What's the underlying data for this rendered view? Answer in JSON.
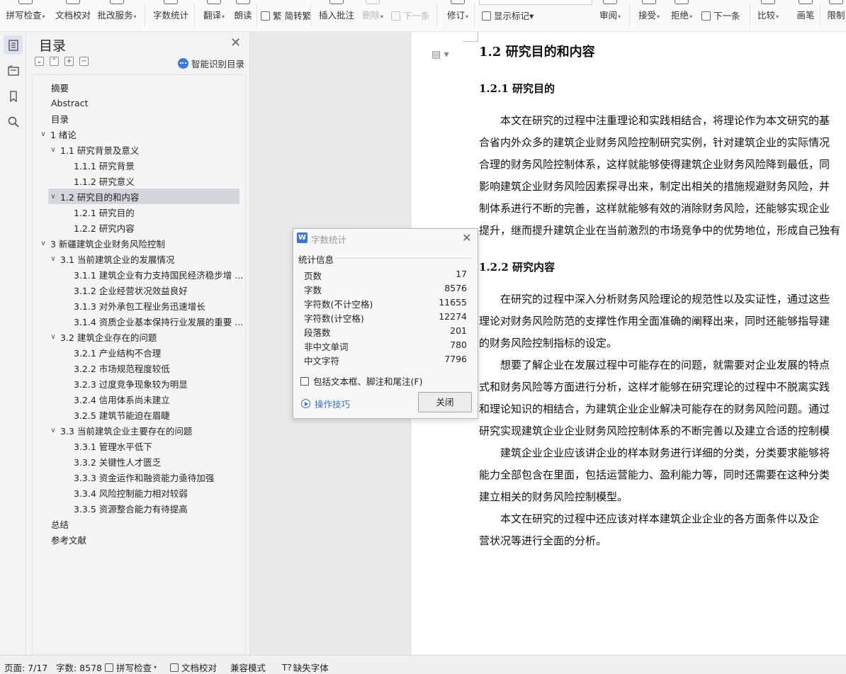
{
  "ribbon": {
    "items": [
      {
        "label": "拼写检查",
        "dropdown": true
      },
      {
        "label": "文档校对",
        "dropdown": false
      },
      {
        "label": "批改服务",
        "dropdown": true
      },
      {
        "label": "字数统计",
        "dropdown": false
      },
      {
        "label": "翻译",
        "dropdown": true
      },
      {
        "label": "朗读",
        "dropdown": false
      },
      {
        "label": "繁 简转繁",
        "dropdown": false
      },
      {
        "label": "插入批注",
        "dropdown": false
      },
      {
        "label": "删除",
        "dropdown": true,
        "disabled": true
      },
      {
        "label": "下一条",
        "dropdown": false,
        "disabled": true
      },
      {
        "label": "修订",
        "dropdown": true
      },
      {
        "label": "显示标记",
        "dropdown": true
      },
      {
        "label": "审阅",
        "dropdown": true
      },
      {
        "label": "接受",
        "dropdown": true
      },
      {
        "label": "拒绝",
        "dropdown": true
      },
      {
        "label": "下一条",
        "dropdown": false
      },
      {
        "label": "比较",
        "dropdown": true
      },
      {
        "label": "画笔",
        "dropdown": false
      },
      {
        "label": "限制",
        "dropdown": false
      }
    ],
    "dropdown_glyph": "▾"
  },
  "rail": {
    "icons": [
      "toc-icon",
      "outline-icon",
      "bookmark-icon",
      "search-icon"
    ]
  },
  "toc": {
    "title": "目录",
    "close_glyph": "✕",
    "tool_glyphs": [
      "⌄",
      "⌃",
      "+",
      "−"
    ],
    "smart_label": "智能识别目录",
    "items": [
      {
        "label": "摘要",
        "level": 0,
        "arrow": ""
      },
      {
        "label": "Abstract",
        "level": 0,
        "arrow": ""
      },
      {
        "label": "目录",
        "level": 0,
        "arrow": ""
      },
      {
        "label": "1  绪论",
        "level": 0,
        "arrow": "∨"
      },
      {
        "label": "1.1  研究背景及意义",
        "level": 1,
        "arrow": "∨"
      },
      {
        "label": "1.1.1 研究背景",
        "level": 2,
        "arrow": ""
      },
      {
        "label": "1.1.2 研究意义",
        "level": 2,
        "arrow": ""
      },
      {
        "label": "1.2 研究目的和内容",
        "level": 1,
        "arrow": "∨",
        "selected": true
      },
      {
        "label": "1.2.1 研究目的",
        "level": 2,
        "arrow": ""
      },
      {
        "label": "1.2.2 研究内容",
        "level": 2,
        "arrow": ""
      },
      {
        "label": "3  新疆建筑企业财务风险控制",
        "level": 0,
        "arrow": "∨"
      },
      {
        "label": "3.1  当前建筑企业的发展情况",
        "level": 1,
        "arrow": "∨"
      },
      {
        "label": "3.1.1 建筑企业有力支持国民经济稳步增 ...",
        "level": 2,
        "arrow": ""
      },
      {
        "label": "3.1.2 企业经营状况效益良好",
        "level": 2,
        "arrow": ""
      },
      {
        "label": "3.1.3  对外承包工程业务迅速增长",
        "level": 2,
        "arrow": ""
      },
      {
        "label": "3.1.4  资质企业基本保持行业发展的重要 ...",
        "level": 2,
        "arrow": ""
      },
      {
        "label": "3.2 建筑企业存在的问题",
        "level": 1,
        "arrow": "∨"
      },
      {
        "label": "3.2.1 产业结构不合理",
        "level": 2,
        "arrow": ""
      },
      {
        "label": "3.2.2 市场规范程度较低",
        "level": 2,
        "arrow": ""
      },
      {
        "label": "3.2.3 过度竞争现象较为明显",
        "level": 2,
        "arrow": ""
      },
      {
        "label": "3.2.4 信用体系尚未建立",
        "level": 2,
        "arrow": ""
      },
      {
        "label": "3.2.5 建筑节能迫在眉睫",
        "level": 2,
        "arrow": ""
      },
      {
        "label": "3.3 当前建筑企业主要存在的问题",
        "level": 1,
        "arrow": "∨"
      },
      {
        "label": "3.3.1 管理水平低下",
        "level": 2,
        "arrow": ""
      },
      {
        "label": "3.3.2 关键性人才匮乏",
        "level": 2,
        "arrow": ""
      },
      {
        "label": "3.3.3 资金运作和融资能力亟待加强",
        "level": 2,
        "arrow": ""
      },
      {
        "label": "3.3.4 风险控制能力相对较弱",
        "level": 2,
        "arrow": ""
      },
      {
        "label": "3.3.5 资源整合能力有待提高",
        "level": 2,
        "arrow": ""
      },
      {
        "label": "总结",
        "level": 0,
        "arrow": ""
      },
      {
        "label": "参考文献",
        "level": 0,
        "arrow": ""
      }
    ]
  },
  "document": {
    "side_icon": "▤ ▾",
    "h2": "1.2 研究目的和内容",
    "h3a": "1.2.1 研究目的",
    "para1": [
      "　　本文在研究的过程中注重理论和实践相结合，将理论作为本文研究的基",
      "合省内外众多的建筑企业财务风险控制研究实例，针对建筑企业的实际情况",
      "合理的财务风险控制体系，这样就能够使得建筑企业财务风险降到最低，同",
      "影响建筑企业财务风险因素探寻出来，制定出相关的措施规避财务风险，并",
      "制体系进行不断的完善，这样就能够有效的消除财务风险，还能够实现企业",
      "提升，继而提升建筑企业在当前激烈的市场竞争中的优势地位，形成自己独有"
    ],
    "h3b": "1.2.2 研究内容",
    "para2": [
      "　　在研究的过程中深入分析财务风险理论的规范性以及实证性，通过这些",
      "理论对财务风险防范的支撑性作用全面准确的阐释出来，同时还能够指导建",
      "的财务风险控制指标的设定。",
      "　　想要了解企业在发展过程中可能存在的问题，就需要对企业发展的特点",
      "式和财务风险等方面进行分析，这样才能够在研究理论的过程中不脱离实践",
      "和理论知识的相结合，为建筑企业企业解决可能存在的财务风险问题。通过",
      "研究实现建筑企业企业财务风险控制体系的不断完善以及建立合适的控制模",
      "　　建筑企业企业应该讲企业的样本财务进行详细的分类，分类要求能够将",
      "能力全部包含在里面，包括运营能力、盈利能力等，同时还需要在这种分类",
      "建立相关的财务风险控制模型。",
      "　　本文在研究的过程中还应该对样本建筑企业企业的各方面条件以及企",
      "营状况等进行全面的分析。"
    ]
  },
  "dialog": {
    "logo": "W",
    "title": "字数统计",
    "close_glyph": "✕",
    "section": "统计信息",
    "stats": [
      {
        "label": "页数",
        "value": "17"
      },
      {
        "label": "字数",
        "value": "8576"
      },
      {
        "label": "字符数(不计空格)",
        "value": "11655"
      },
      {
        "label": "字符数(计空格)",
        "value": "12274"
      },
      {
        "label": "段落数",
        "value": "201"
      },
      {
        "label": "非中文单词",
        "value": "780"
      },
      {
        "label": "中文字符",
        "value": "7796"
      }
    ],
    "checkbox_label": "包括文本框、脚注和尾注(F)",
    "checkbox_checked": false,
    "tips_label": "操作技巧",
    "close_button": "关闭"
  },
  "statusbar": {
    "page": "页面: 7/17",
    "words": "字数: 8578",
    "spell": "拼写检查",
    "proof": "文档校对",
    "compat": "兼容模式",
    "missing_font": "缺失字体",
    "dropdown_glyph": "▾"
  },
  "colors": {
    "accent": "#3a75d8",
    "link": "#3a72c9",
    "selected_toc": "#d3d6db",
    "panel_bg": "#f3f3f3",
    "doc_gray": "#e9e9e9"
  }
}
